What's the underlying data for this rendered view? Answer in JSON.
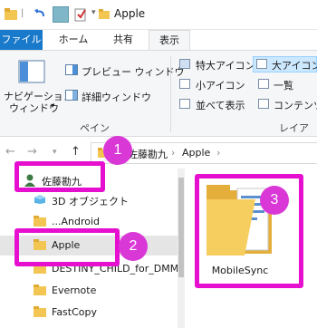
{
  "window": {
    "title": "Apple"
  },
  "ribbon_tabs": [
    "ファイル",
    "ホーム",
    "共有",
    "表示"
  ],
  "ribbon": {
    "navigation_pane_line1": "ナビゲーション",
    "navigation_pane_line2": "ウィンドウ",
    "preview_pane": "プレビュー ウィンドウ",
    "details_pane": "詳細ウィンドウ",
    "pane_group": "ペイン",
    "layouts": [
      "特大アイコン",
      "大アイコン",
      "小アイコン",
      "一覧",
      "並べて表示",
      "コンテンツ"
    ],
    "layout_group": "レイアウト"
  },
  "address": {
    "crumbs": [
      "佐藤勘九",
      "Apple"
    ],
    "separator": "›"
  },
  "nav_pane": {
    "items": [
      {
        "label": "佐藤勘九",
        "icon": "user-icon"
      },
      {
        "label": "3D オブジェクト",
        "icon": "3d-objects-icon"
      },
      {
        "label": "...Android",
        "icon": "folder-icon"
      },
      {
        "label": "Apple",
        "icon": "folder-icon",
        "selected": true
      },
      {
        "label": "DESTINY_CHILD_for_DMM",
        "icon": "folder-icon"
      },
      {
        "label": "Evernote",
        "icon": "folder-icon"
      },
      {
        "label": "FastCopy",
        "icon": "folder-icon"
      }
    ]
  },
  "content": {
    "items": [
      {
        "label": "MobileSync",
        "icon": "folder-with-documents-icon"
      }
    ]
  },
  "annotations": [
    {
      "number": "1",
      "target": "user-folder"
    },
    {
      "number": "2",
      "target": "apple-folder"
    },
    {
      "number": "3",
      "target": "mobilesync-folder"
    }
  ],
  "colors": {
    "highlight": "#e60fcf",
    "badge": "#d938d7",
    "file_tab": "#1979ca",
    "folder": "#f3c654"
  }
}
